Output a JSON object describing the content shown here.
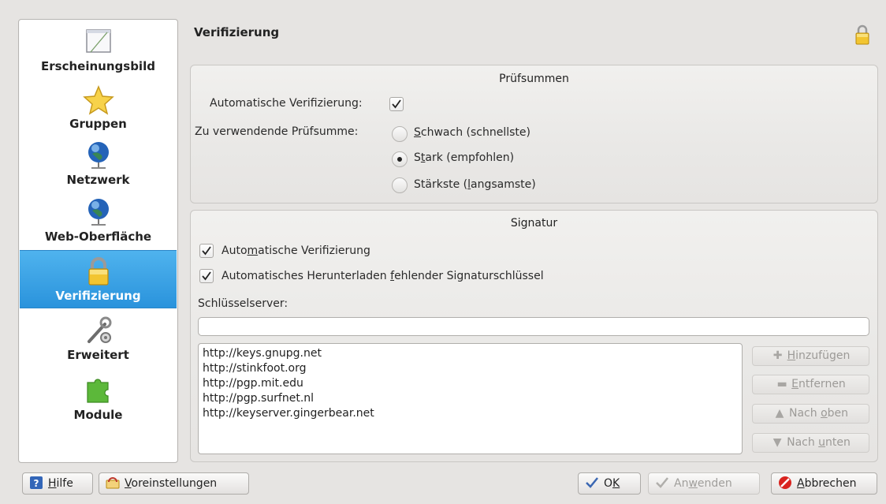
{
  "sidebar": {
    "items": [
      {
        "label": "Erscheinungsbild",
        "icon": "appearance-icon"
      },
      {
        "label": "Gruppen",
        "icon": "star-icon"
      },
      {
        "label": "Netzwerk",
        "icon": "network-globe-icon"
      },
      {
        "label": "Web-Oberfläche",
        "icon": "web-globe-icon"
      },
      {
        "label": "Verifizierung",
        "icon": "lock-icon",
        "selected": true
      },
      {
        "label": "Erweitert",
        "icon": "tools-icon"
      },
      {
        "label": "Module",
        "icon": "puzzle-icon"
      }
    ]
  },
  "header": {
    "title": "Verifizierung",
    "icon": "lock-icon"
  },
  "checksums": {
    "title": "Prüfsummen",
    "auto_label": "Automatische Verifizierung:",
    "auto_checked": true,
    "checksum_label": "Zu verwendende Prüfsumme:",
    "options": [
      {
        "label_pre": "",
        "mnemonic": "S",
        "label_post": "chwach (schnellste)",
        "selected": false
      },
      {
        "label_pre": "S",
        "mnemonic": "t",
        "label_post": "ark (empfohlen)",
        "selected": true
      },
      {
        "label_pre": "Stärkste (",
        "mnemonic": "l",
        "label_post": "angsamste)",
        "selected": false
      }
    ]
  },
  "signature": {
    "title": "Signatur",
    "auto_verify": {
      "pre": "Auto",
      "mnemonic": "m",
      "post": "atische Verifizierung",
      "checked": true
    },
    "auto_download": {
      "pre": "Automatisches Herunterladen ",
      "mnemonic": "f",
      "post": "ehlender Signaturschlüssel",
      "checked": true
    },
    "keyserver_label": "Schlüsselserver:",
    "keyserver_value": "",
    "servers": [
      "http://keys.gnupg.net",
      "http://stinkfoot.org",
      "http://pgp.mit.edu",
      "http://pgp.surfnet.nl",
      "http://keyserver.gingerbear.net"
    ],
    "buttons": [
      {
        "pre": "",
        "mnemonic": "H",
        "post": "inzufügen",
        "icon": "add-icon"
      },
      {
        "pre": "",
        "mnemonic": "E",
        "post": "ntfernen",
        "icon": "remove-icon"
      },
      {
        "pre": "Nach ",
        "mnemonic": "o",
        "post": "ben",
        "icon": "arrow-up-icon"
      },
      {
        "pre": "Nach ",
        "mnemonic": "u",
        "post": "nten",
        "icon": "arrow-down-icon"
      }
    ]
  },
  "footer": {
    "help": {
      "pre": "",
      "mnemonic": "H",
      "post": "ilfe"
    },
    "defaults": {
      "pre": "",
      "mnemonic": "V",
      "post": "oreinstellungen"
    },
    "ok": {
      "pre": "O",
      "mnemonic": "K",
      "post": ""
    },
    "apply": {
      "pre": "An",
      "mnemonic": "w",
      "post": "enden"
    },
    "cancel": {
      "pre": "",
      "mnemonic": "A",
      "post": "bbrechen"
    }
  },
  "colors": {
    "selection": "#3a9fe3",
    "window_bg": "#e6e4e2",
    "cancel_red": "#d9231e"
  }
}
